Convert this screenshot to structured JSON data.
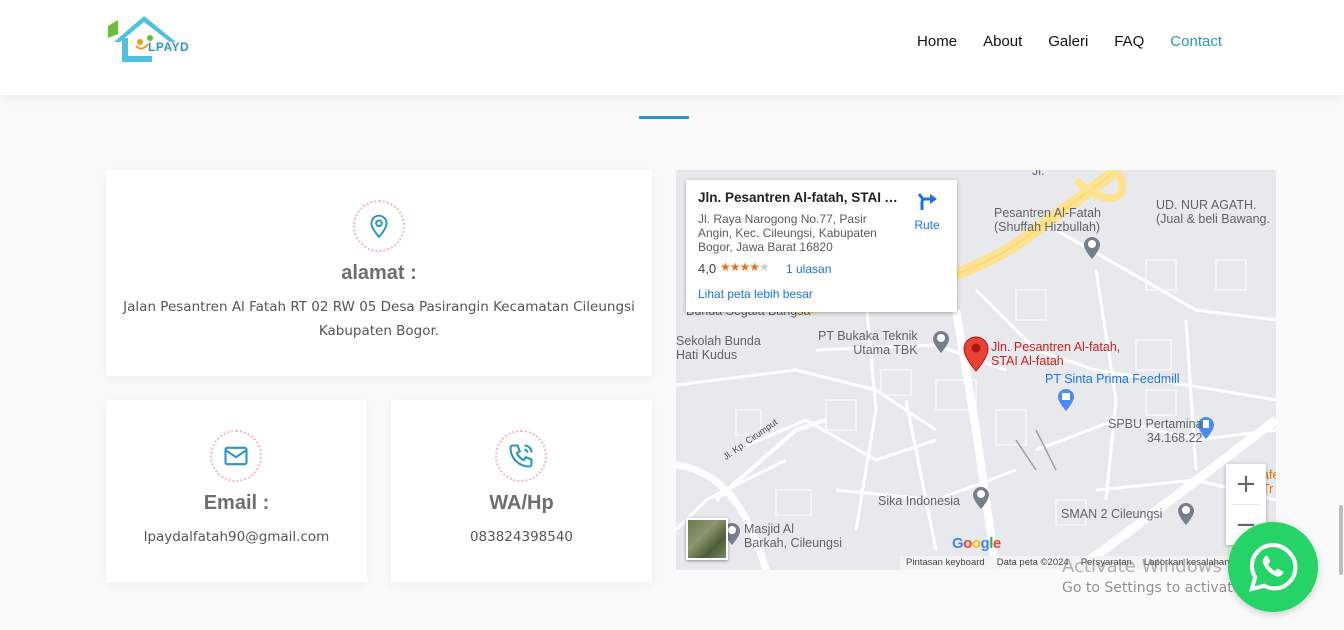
{
  "header": {
    "logo_text": "LPAYD",
    "nav": [
      {
        "label": "Home"
      },
      {
        "label": "About"
      },
      {
        "label": "Galeri"
      },
      {
        "label": "FAQ"
      },
      {
        "label": "Contact",
        "active": true
      }
    ]
  },
  "cards": {
    "address": {
      "icon": "location-pin-icon",
      "title": "alamat :",
      "text": "Jalan Pesantren Al Fatah RT 02 RW 05 Desa Pasirangin Kecamatan Cileungsi Kabupaten Bogor."
    },
    "email": {
      "icon": "envelope-icon",
      "title": "Email :",
      "text": "lpaydalfatah90@gmail.com"
    },
    "phone": {
      "icon": "phone-icon",
      "title": "WA/Hp",
      "text": "083824398540"
    }
  },
  "map": {
    "info": {
      "title": "Jln. Pesantren Al-fatah, STAI Al-fatah",
      "address": "Jl. Raya Narogong No.77, Pasir Angin, Kec. Cileungsi, Kabupaten Bogor, Jawa Barat 16820",
      "rating": "4,0",
      "stars": 4,
      "reviews": "1 ulasan",
      "route": "Rute",
      "larger_map": "Lihat peta lebih besar"
    },
    "labels": {
      "nur_agath1": "UD. NUR AGATH.",
      "nur_agath2": "(Jual & beli Bawang.",
      "pesantren1": "Pesantren Al-Fatah",
      "pesantren2": "(Shuffah Hizbullah)",
      "bunda_segala": "Bunda Segala Bangsa",
      "sekolah1": "Sekolah Bunda",
      "sekolah2": "Hati Kudus",
      "bukaka1": "PT Bukaka Teknik",
      "bukaka2": "Utama TBK",
      "pin1": "Jln. Pesantren Al-fatah,",
      "pin2": "STAI Al-fatah",
      "sinta": "PT Sinta Prima Feedmill",
      "spbu1": "SPBU Pertamina",
      "spbu2": "34.168.22",
      "jl_cirumput": "Jl. Kp. Cirumput",
      "sika": "Sika Indonesia",
      "sman": "SMAN 2 Cileungsi",
      "masjid1": "Masjid Al",
      "masjid2": "Barkah, Cileungsi",
      "jl_top": "Jl.",
      "edge1": "afe",
      "edge2": "Tr",
      "edge3": "E"
    },
    "zoom_in": "+",
    "zoom_out": "−",
    "footer": [
      "Pintasan keyboard",
      "Data peta ©2024",
      "Persyaratan",
      "Laporkan kesalahan"
    ]
  },
  "watermark": {
    "line1": "Activate Windows",
    "line2": "Go to Settings to activate Windows."
  },
  "colors": {
    "accent": "#2b95c3",
    "whatsapp": "#25d366",
    "pin": "#ea4335"
  }
}
